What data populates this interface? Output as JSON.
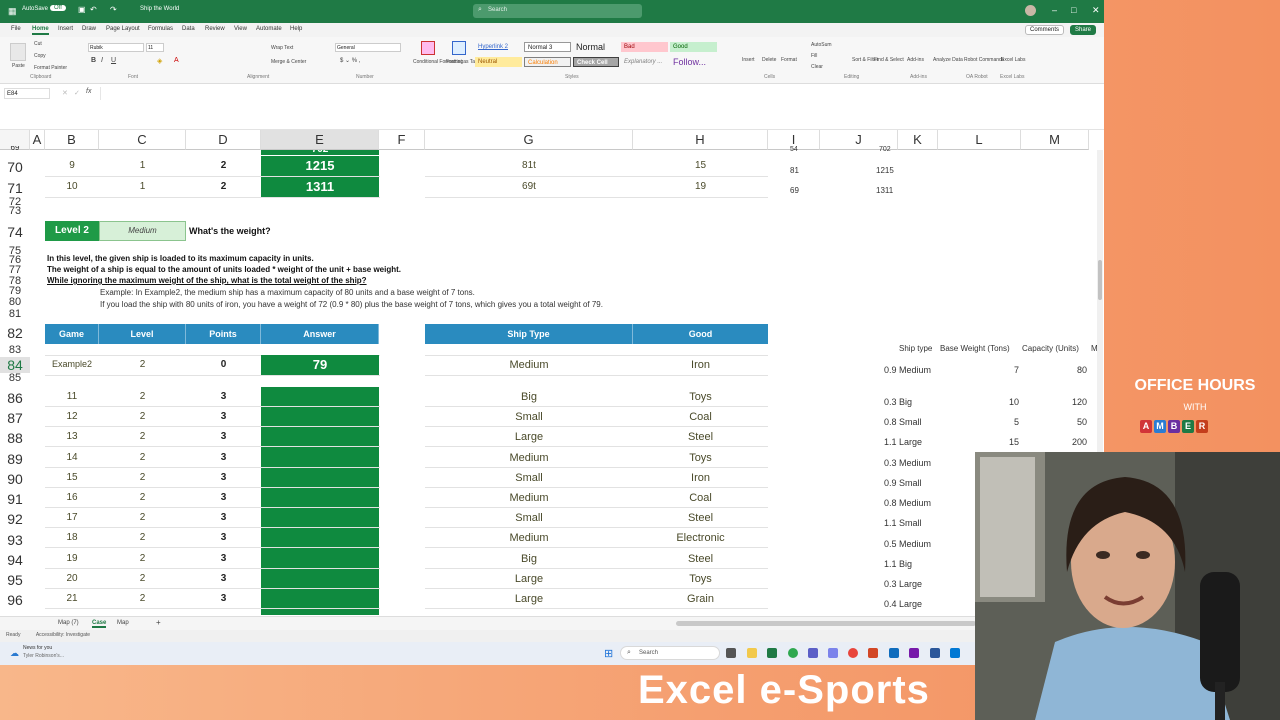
{
  "titlebar": {
    "autosave_label": "AutoSave",
    "autosave_state": "Off",
    "file_title": "Ship the World",
    "search_placeholder": "Search"
  },
  "menu": {
    "items": [
      "File",
      "Home",
      "Insert",
      "Draw",
      "Page Layout",
      "Formulas",
      "Data",
      "Review",
      "View",
      "Automate",
      "Help"
    ],
    "comments_label": "Comments",
    "share_label": "Share"
  },
  "ribbon": {
    "clipboard": {
      "paste": "Paste",
      "cut": "Cut",
      "copy": "Copy",
      "format_painter": "Format Painter",
      "group": "Clipboard"
    },
    "font": {
      "name": "Rubik",
      "size": "11",
      "group": "Font"
    },
    "alignment": {
      "wrap": "Wrap Text",
      "merge": "Merge & Center",
      "group": "Alignment"
    },
    "number": {
      "format": "General",
      "group": "Number"
    },
    "styles": {
      "conditional": "Conditional Formatting",
      "format_table": "Format as Table",
      "group": "Styles",
      "cells": [
        "Hyperlink 2",
        "Normal 3",
        "Normal",
        "Bad",
        "Good",
        "Neutral",
        "Calculation",
        "Check Cell",
        "Explanatory ...",
        "Follow..."
      ]
    },
    "cells": {
      "insert": "Insert",
      "delete": "Delete",
      "format": "Format",
      "group": "Cells"
    },
    "editing": {
      "autosum": "AutoSum",
      "fill": "Fill",
      "clear": "Clear",
      "sort": "Sort & Filter",
      "find": "Find & Select",
      "group": "Editing"
    },
    "addins": {
      "addins": "Add-ins",
      "analyze": "Analyze Data",
      "robot": "Robot Commands",
      "labs": "Excel Labs",
      "g1": "Add-ins",
      "g2": "OA Robot",
      "g3": "Excel Labs"
    }
  },
  "formula_bar": {
    "name_box": "E84",
    "fx": "fx"
  },
  "columns": [
    "A",
    "B",
    "C",
    "D",
    "E",
    "F",
    "G",
    "H",
    "I",
    "J",
    "K",
    "L",
    "M"
  ],
  "row_numbers": [
    "69",
    "70",
    "71",
    "72",
    "73",
    "74",
    "75",
    "76",
    "77",
    "78",
    "79",
    "80",
    "81",
    "82",
    "83",
    "84",
    "85",
    "86",
    "87",
    "88",
    "89",
    "90",
    "91",
    "92",
    "93",
    "94",
    "95",
    "96"
  ],
  "top_rows": [
    {
      "game": "9",
      "level": "1",
      "points": "2",
      "answer": "1215",
      "ship": "81t",
      "good": "15",
      "i": "81",
      "j": "1215"
    },
    {
      "game": "10",
      "level": "1",
      "points": "2",
      "answer": "1311",
      "ship": "69t",
      "good": "19",
      "i": "69",
      "j": "1311"
    }
  ],
  "partial_row": {
    "answer": "702",
    "i": "54",
    "j": "702"
  },
  "level": {
    "label": "Level 2",
    "difficulty": "Medium",
    "question": "What's the weight?"
  },
  "instructions": [
    "In this level, the given ship is loaded to its maximum capacity in units.",
    "The weight of a ship is equal to the amount of units loaded * weight of the unit + base weight.",
    "While ignoring the maximum weight of the ship, what is the total weight of the ship?",
    "Example: In Example2, the medium ship has a maximum capacity of 80 units and a base weight of 7 tons.",
    "If you load the ship with 80 units of iron, you have a weight of 72 (0.9 * 80) plus the base weight of 7 tons, which gives you a total weight of 79."
  ],
  "table_headers": {
    "game": "Game",
    "level": "Level",
    "points": "Points",
    "answer": "Answer",
    "ship_type": "Ship Type",
    "good": "Good"
  },
  "example_row": {
    "game": "Example2",
    "level": "2",
    "points": "0",
    "answer": "79",
    "ship": "Medium",
    "good": "Iron"
  },
  "rows": [
    {
      "game": "11",
      "level": "2",
      "points": "3",
      "ship": "Big",
      "good": "Toys"
    },
    {
      "game": "12",
      "level": "2",
      "points": "3",
      "ship": "Small",
      "good": "Coal"
    },
    {
      "game": "13",
      "level": "2",
      "points": "3",
      "ship": "Large",
      "good": "Steel"
    },
    {
      "game": "14",
      "level": "2",
      "points": "3",
      "ship": "Medium",
      "good": "Toys"
    },
    {
      "game": "15",
      "level": "2",
      "points": "3",
      "ship": "Small",
      "good": "Iron"
    },
    {
      "game": "16",
      "level": "2",
      "points": "3",
      "ship": "Medium",
      "good": "Coal"
    },
    {
      "game": "17",
      "level": "2",
      "points": "3",
      "ship": "Small",
      "good": "Steel"
    },
    {
      "game": "18",
      "level": "2",
      "points": "3",
      "ship": "Medium",
      "good": "Electronic"
    },
    {
      "game": "19",
      "level": "2",
      "points": "3",
      "ship": "Big",
      "good": "Steel"
    },
    {
      "game": "20",
      "level": "2",
      "points": "3",
      "ship": "Large",
      "good": "Toys"
    },
    {
      "game": "21",
      "level": "2",
      "points": "3",
      "ship": "Large",
      "good": "Grain"
    }
  ],
  "ref_table": {
    "headers": [
      "Ship type",
      "Base Weight (Tons)",
      "Capacity (Units)",
      "M"
    ],
    "rows": [
      {
        "label": "0.9 Medium",
        "base": "7",
        "cap": "80"
      },
      {
        "label": "0.3 Big",
        "base": "10",
        "cap": "120"
      },
      {
        "label": "0.8 Small",
        "base": "5",
        "cap": "50"
      },
      {
        "label": "1.1 Large",
        "base": "15",
        "cap": "200"
      },
      {
        "label": "0.3 Medium"
      },
      {
        "label": "0.9 Small"
      },
      {
        "label": "0.8 Medium"
      },
      {
        "label": "1.1 Small"
      },
      {
        "label": "0.5 Medium"
      },
      {
        "label": "1.1 Big"
      },
      {
        "label": "0.3 Large"
      },
      {
        "label": "0.4 Large"
      }
    ]
  },
  "sheets": {
    "tabs": [
      "Map (7)",
      "Case",
      "Map"
    ],
    "add": "+"
  },
  "status": {
    "ready": "Ready",
    "accessibility": "Accessibility: Investigate"
  },
  "taskbar": {
    "news_title": "News for you",
    "news_sub": "Tyler Robinson's...",
    "search": "Search"
  },
  "branding": {
    "office_hours": "OFFICE HOURS",
    "with": "WITH",
    "amber": [
      "A",
      "M",
      "B",
      "E",
      "R"
    ],
    "amber_colors": [
      "#d13438",
      "#2b7cd3",
      "#6b2fa0",
      "#1f7a45",
      "#c43e1c"
    ],
    "esports": "Excel e-Sports"
  },
  "colors": {
    "excel_green": "#1f7a45",
    "answer_green": "#0f8a3f",
    "header_blue": "#2a8bbf"
  }
}
